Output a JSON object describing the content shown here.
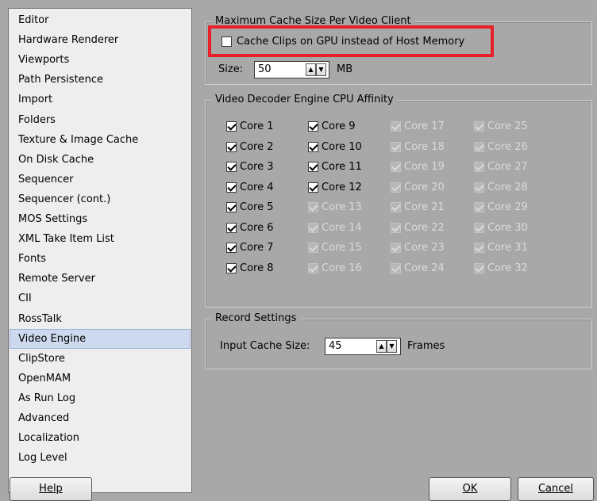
{
  "sidebar": {
    "items": [
      {
        "label": "Editor"
      },
      {
        "label": "Hardware Renderer"
      },
      {
        "label": "Viewports"
      },
      {
        "label": "Path Persistence"
      },
      {
        "label": "Import"
      },
      {
        "label": "Folders"
      },
      {
        "label": "Texture & Image Cache"
      },
      {
        "label": "On Disk Cache"
      },
      {
        "label": "Sequencer"
      },
      {
        "label": "Sequencer (cont.)"
      },
      {
        "label": "MOS Settings"
      },
      {
        "label": "XML Take Item List"
      },
      {
        "label": "Fonts"
      },
      {
        "label": "Remote Server"
      },
      {
        "label": "CII"
      },
      {
        "label": "RossTalk"
      },
      {
        "label": "Video Engine"
      },
      {
        "label": "ClipStore"
      },
      {
        "label": "OpenMAM"
      },
      {
        "label": "As Run Log"
      },
      {
        "label": "Advanced"
      },
      {
        "label": "Localization"
      },
      {
        "label": "Log Level"
      }
    ],
    "selected": "Video Engine"
  },
  "cache": {
    "group_title": "Maximum Cache Size Per Video Client",
    "gpu_checkbox_label": "Cache Clips on GPU instead of Host Memory",
    "gpu_checked": false,
    "size_label": "Size:",
    "size_value": "50",
    "size_unit": "MB"
  },
  "affinity": {
    "group_title": "Video Decoder Engine CPU Affinity",
    "cores": [
      {
        "label": "Core 1",
        "checked": true,
        "enabled": true
      },
      {
        "label": "Core 2",
        "checked": true,
        "enabled": true
      },
      {
        "label": "Core 3",
        "checked": true,
        "enabled": true
      },
      {
        "label": "Core 4",
        "checked": true,
        "enabled": true
      },
      {
        "label": "Core 5",
        "checked": true,
        "enabled": true
      },
      {
        "label": "Core 6",
        "checked": true,
        "enabled": true
      },
      {
        "label": "Core 7",
        "checked": true,
        "enabled": true
      },
      {
        "label": "Core 8",
        "checked": true,
        "enabled": true
      },
      {
        "label": "Core 9",
        "checked": true,
        "enabled": true
      },
      {
        "label": "Core 10",
        "checked": true,
        "enabled": true
      },
      {
        "label": "Core 11",
        "checked": true,
        "enabled": true
      },
      {
        "label": "Core 12",
        "checked": true,
        "enabled": true
      },
      {
        "label": "Core 13",
        "checked": true,
        "enabled": false
      },
      {
        "label": "Core 14",
        "checked": true,
        "enabled": false
      },
      {
        "label": "Core 15",
        "checked": true,
        "enabled": false
      },
      {
        "label": "Core 16",
        "checked": true,
        "enabled": false
      },
      {
        "label": "Core 17",
        "checked": true,
        "enabled": false
      },
      {
        "label": "Core 18",
        "checked": true,
        "enabled": false
      },
      {
        "label": "Core 19",
        "checked": true,
        "enabled": false
      },
      {
        "label": "Core 20",
        "checked": true,
        "enabled": false
      },
      {
        "label": "Core 21",
        "checked": true,
        "enabled": false
      },
      {
        "label": "Core 22",
        "checked": true,
        "enabled": false
      },
      {
        "label": "Core 23",
        "checked": true,
        "enabled": false
      },
      {
        "label": "Core 24",
        "checked": true,
        "enabled": false
      },
      {
        "label": "Core 25",
        "checked": true,
        "enabled": false
      },
      {
        "label": "Core 26",
        "checked": true,
        "enabled": false
      },
      {
        "label": "Core 27",
        "checked": true,
        "enabled": false
      },
      {
        "label": "Core 28",
        "checked": true,
        "enabled": false
      },
      {
        "label": "Core 29",
        "checked": true,
        "enabled": false
      },
      {
        "label": "Core 30",
        "checked": true,
        "enabled": false
      },
      {
        "label": "Core 31",
        "checked": true,
        "enabled": false
      },
      {
        "label": "Core 32",
        "checked": true,
        "enabled": false
      }
    ]
  },
  "record": {
    "group_title": "Record Settings",
    "input_cache_label": "Input Cache Size:",
    "input_cache_value": "45",
    "input_cache_unit": "Frames"
  },
  "buttons": {
    "help": "Help",
    "ok": "OK",
    "cancel": "Cancel"
  },
  "icons": {
    "spin_up": "arrow-up-icon",
    "spin_down": "arrow-down-icon"
  },
  "colors": {
    "highlight": "#e8202a",
    "selection": "#cdd9ee"
  }
}
